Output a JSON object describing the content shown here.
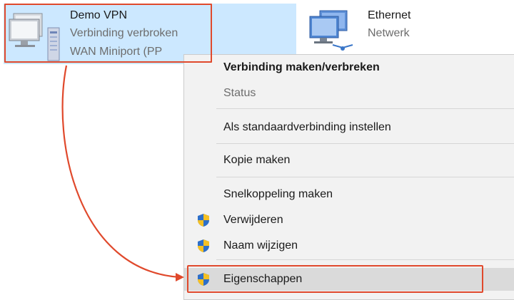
{
  "adapters": [
    {
      "name": "Demo VPN",
      "status": "Verbinding verbroken",
      "device": "WAN Miniport (PP"
    },
    {
      "name": "Ethernet",
      "status": "Netwerk"
    }
  ],
  "menu": {
    "items": [
      {
        "label": "Verbinding maken/verbreken"
      },
      {
        "label": "Status"
      },
      {
        "label": "Als standaardverbinding instellen"
      },
      {
        "label": "Kopie maken"
      },
      {
        "label": "Snelkoppeling maken"
      },
      {
        "label": "Verwijderen",
        "icon": "uac-shield-icon"
      },
      {
        "label": "Naam wijzigen",
        "icon": "uac-shield-icon"
      },
      {
        "label": "Eigenschappen",
        "icon": "uac-shield-icon"
      }
    ]
  },
  "colors": {
    "selection": "#cce8ff",
    "annotation": "#e0492c",
    "menu_bg": "#f2f2f2",
    "hover": "#dadada"
  }
}
